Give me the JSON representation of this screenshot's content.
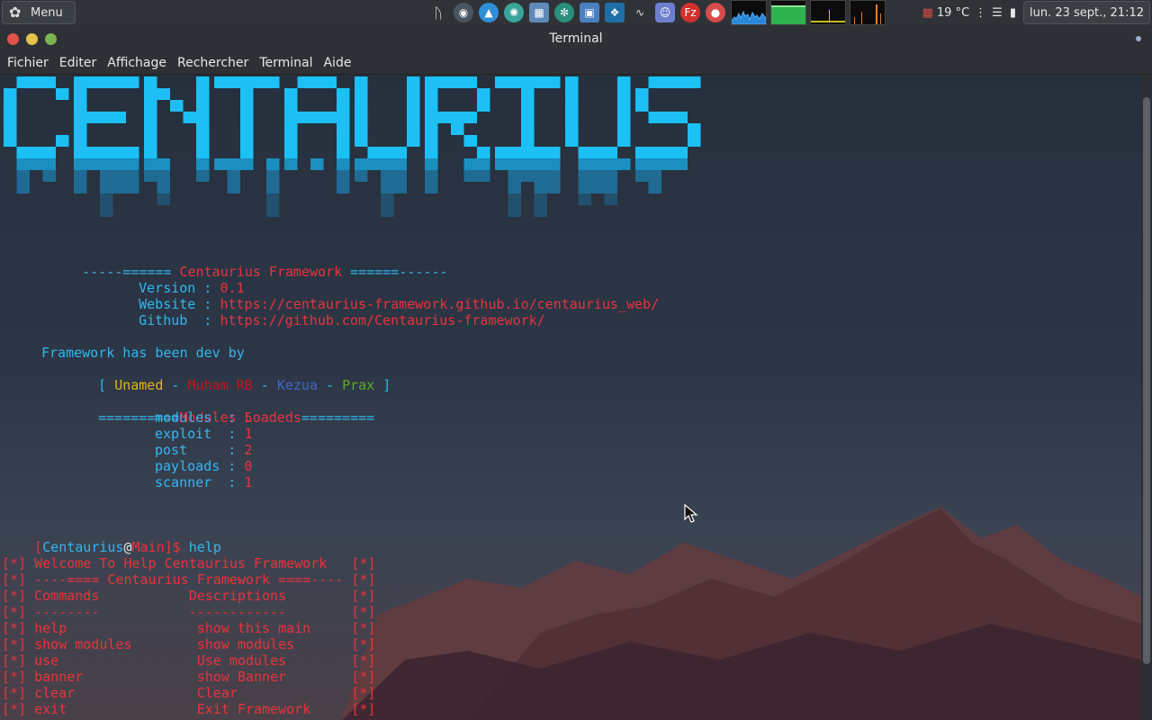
{
  "panel": {
    "menu_label": "Menu",
    "temperature": "19 °C",
    "clock": "lun. 23 sept., 21:12",
    "tray_icons": [
      "bluetooth-icon",
      "eye-icon",
      "shark-icon",
      "swirl-icon",
      "calendar-icon",
      "spiral-icon",
      "folder-icon",
      "kodi-icon",
      "audio-wave-icon",
      "discord-icon",
      "filezilla-icon",
      "recorder-icon"
    ]
  },
  "window": {
    "title": "Terminal"
  },
  "menubar": {
    "items": [
      "Fichier",
      "Editer",
      "Affichage",
      "Rechercher",
      "Terminal",
      "Aide"
    ]
  },
  "banner_text": "CENTAURIUS",
  "terminal": {
    "header_left": "-----====== ",
    "header_title": "Centaurius Framework",
    "header_right": " ======------",
    "version_label": "Version : ",
    "version_value": "0.1",
    "website_label": "Website : ",
    "website_value": "https://centaurius-framework.github.io/centaurius_web/",
    "github_label": "Github  : ",
    "github_value": "https://github.com/Centaurius-framework/",
    "dev_by": "Framework has been dev by",
    "dev_open": "[ ",
    "dev_1": "Unamed",
    "dev_sep": " - ",
    "dev_2": "Muham RB",
    "dev_3": "Kezua",
    "dev_4": "Prax",
    "dev_close": " ]",
    "modules_left": "==========",
    "modules_title": "Modules Loadeds",
    "modules_right": "=========",
    "modules": [
      {
        "label": "modules  : ",
        "value": "5"
      },
      {
        "label": "exploit  : ",
        "value": "1"
      },
      {
        "label": "post     : ",
        "value": "2"
      },
      {
        "label": "payloads : ",
        "value": "0"
      },
      {
        "label": "scanner  : ",
        "value": "1"
      }
    ],
    "prompt_open": "[",
    "prompt_user": "Centaurius",
    "prompt_at": "@",
    "prompt_host": "Main",
    "prompt_close": "]$ ",
    "command": "help",
    "help_lines": [
      {
        "star": "[*]",
        "text": " Welcome To Help Centaurius Framework   ",
        "end": "[*]"
      },
      {
        "star": "[*]",
        "text": " ----==== Centaurius Framework ====---- ",
        "end": "[*]"
      },
      {
        "star": "[*]",
        "text": " Commands           Descriptions        ",
        "end": "[*]"
      },
      {
        "star": "[*]",
        "text": " --------           ------------        ",
        "end": "[*]"
      },
      {
        "star": "[*]",
        "text": " help                show this main     ",
        "end": "[*]"
      },
      {
        "star": "[*]",
        "text": " show modules        show modules       ",
        "end": "[*]"
      },
      {
        "star": "[*]",
        "text": " use                 Use modules        ",
        "end": "[*]"
      },
      {
        "star": "[*]",
        "text": " banner              show Banner        ",
        "end": "[*]"
      },
      {
        "star": "[*]",
        "text": " clear               Clear              ",
        "end": "[*]"
      },
      {
        "star": "[*]",
        "text": " exit                Exit Framework     ",
        "end": "[*]"
      }
    ]
  },
  "colors": {
    "accent_blue": "#33b7ee",
    "accent_red": "#e8333c",
    "close_button": "#e0534a",
    "minimize_button": "#e4c34c",
    "maximize_button": "#7ab44f"
  }
}
